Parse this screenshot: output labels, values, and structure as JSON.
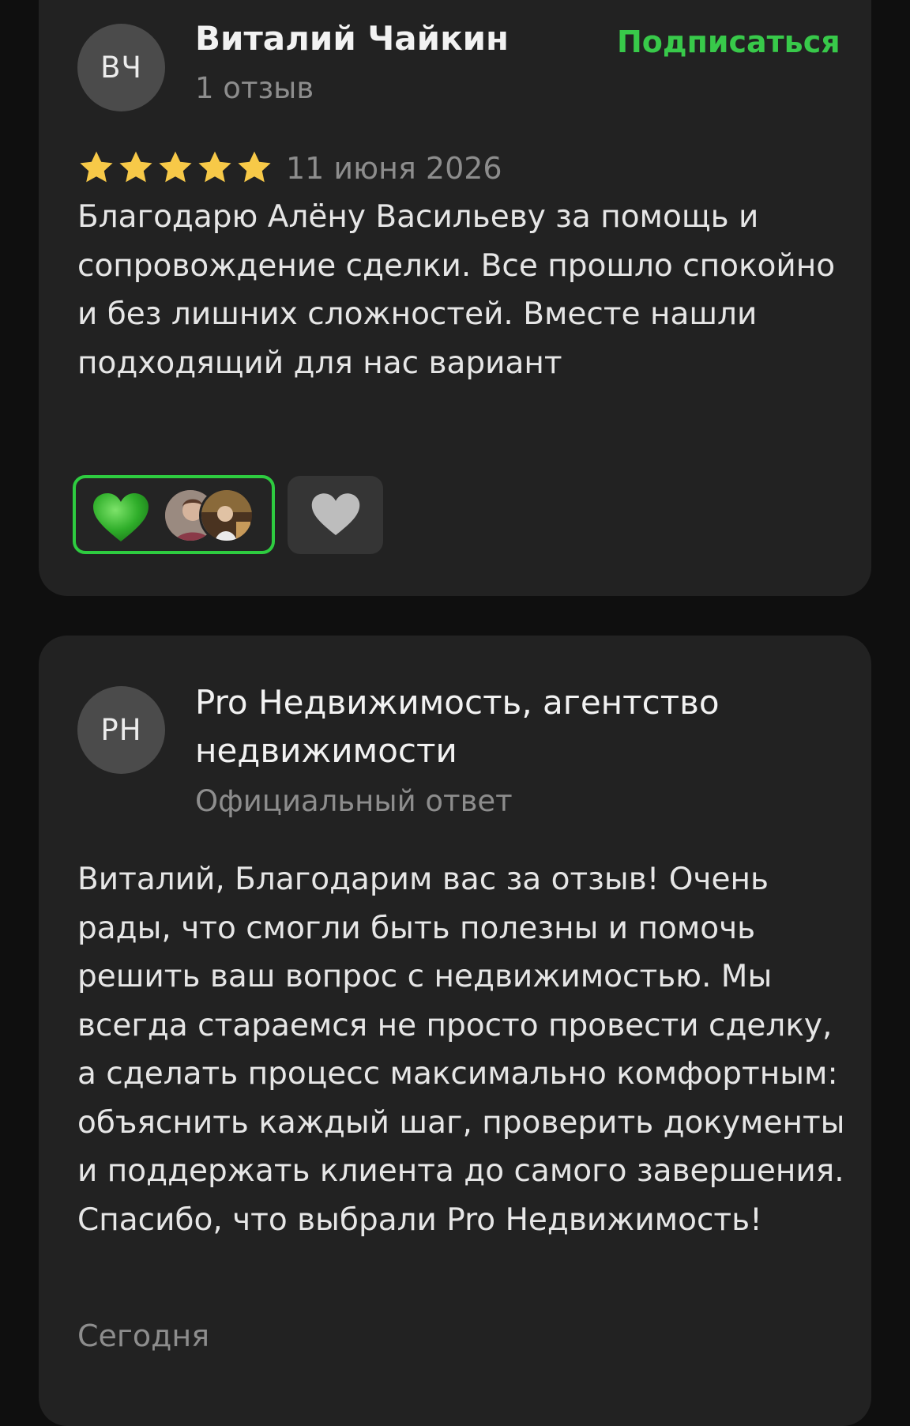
{
  "review": {
    "author_initials": "ВЧ",
    "author_name": "Виталий Чайкин",
    "author_reviews": "1 отзыв",
    "subscribe_label": "Подписаться",
    "rating": 5,
    "rating_max": 5,
    "date": "11 июня 2026",
    "text": "Благодарю Алёну Васильеву за помощь и сопровождение сделки. Все прошло спокойно и без лишних сложностей. Вместе нашли подходящий для нас вариант",
    "reactions": {
      "active_icon": "green-heart-icon",
      "inactive_icon": "grey-heart-icon",
      "reactor_avatars": [
        "user-avatar",
        "user-avatar"
      ]
    }
  },
  "reply": {
    "author_initials": "PH",
    "author_name": "Pro Недвижимость, агентство недвижимости",
    "label": "Официальный ответ",
    "text": "Виталий, Благодарим вас за отзыв! Очень рады, что смогли быть полезны и помочь решить ваш вопрос с недвижимостью. Мы всегда стараемся не просто провести сделку, а сделать процесс максимально комфортным: объяснить каждый шаг, проверить документы и поддержать клиента до самого завершения. Спасибо, что выбрали Pro Недвижимость!",
    "date": "Сегодня"
  },
  "colors": {
    "accent": "#38c94a",
    "star": "#f7c948",
    "card": "#222222",
    "background": "#0f0f0f"
  }
}
